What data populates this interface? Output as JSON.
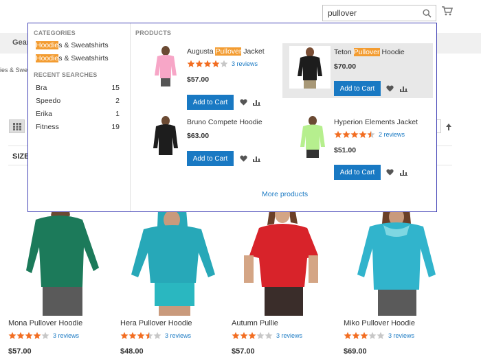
{
  "search": {
    "value": "pullover"
  },
  "nav": {
    "gear_label": "Gear",
    "breadcrumb_text": "ies & Swea"
  },
  "toolbar": {
    "size_label": "SIZE"
  },
  "dropdown": {
    "categories_title": "CATEGORIES",
    "categories": [
      {
        "highlight": "Hoodie",
        "rest": "s & Sweatshirts"
      },
      {
        "highlight": "Hoodie",
        "rest": "s & Sweatshirts"
      }
    ],
    "recent_title": "RECENT SEARCHES",
    "recent": [
      {
        "term": "Bra",
        "count": "15"
      },
      {
        "term": "Speedo",
        "count": "2"
      },
      {
        "term": "Erika",
        "count": "1"
      },
      {
        "term": "Fitness",
        "count": "19"
      }
    ],
    "products_title": "PRODUCTS",
    "products": [
      {
        "name_pre": "Augusta ",
        "name_hl": "Pullover",
        "name_post": " Jacket",
        "stars": 4,
        "reviews": "3 reviews",
        "price": "$57.00",
        "add_label": "Add to Cart"
      },
      {
        "name_pre": "Teton ",
        "name_hl": "Pullover",
        "name_post": " Hoodie",
        "stars": 0,
        "reviews": "",
        "price": "$70.00",
        "add_label": "Add to Cart"
      },
      {
        "name_pre": "Bruno Compete Hoodie",
        "name_hl": "",
        "name_post": "",
        "stars": 0,
        "reviews": "",
        "price": "$63.00",
        "add_label": "Add to Cart"
      },
      {
        "name_pre": "Hyperion Elements Jacket",
        "name_hl": "",
        "name_post": "",
        "stars": 4.5,
        "reviews": "2 reviews",
        "price": "$51.00",
        "add_label": "Add to Cart"
      }
    ],
    "more_products": "More products"
  },
  "grid": [
    {
      "name": "Mona Pullover Hoodie",
      "stars": 4,
      "reviews": "3 reviews",
      "price": "$57.00",
      "color": "#1c7a5a"
    },
    {
      "name": "Hera Pullover Hoodie",
      "stars": 3.5,
      "reviews": "3 reviews",
      "price": "$48.00",
      "color": "#27a8b8"
    },
    {
      "name": "Autumn Pullie",
      "stars": 3,
      "reviews": "3 reviews",
      "price": "$57.00",
      "color": "#d8232a"
    },
    {
      "name": "Miko Pullover Hoodie",
      "stars": 3,
      "reviews": "3 reviews",
      "price": "$69.00",
      "color": "#31b4cc"
    }
  ],
  "colors": {
    "accent": "#1979c3",
    "highlight": "#f39c31",
    "star": "#f26d21",
    "star_empty": "#c7c7c7",
    "dropdown_border": "#3f3fb4"
  }
}
